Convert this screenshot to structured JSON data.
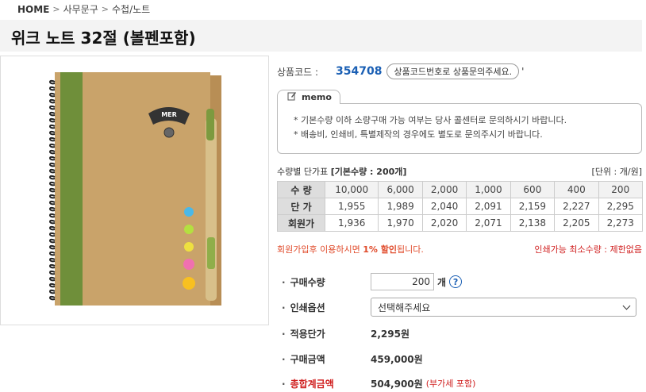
{
  "breadcrumb": {
    "home": "HOME",
    "cat1": "사무문구",
    "cat2": "수첩/노트"
  },
  "product": {
    "title": "위크 노트 32절 (볼펜포함)"
  },
  "code": {
    "label": "상품코드 :",
    "value": "354708",
    "tip": "상품코드번호로 상품문의주세요.",
    "tick": "'"
  },
  "memo": {
    "title": "memo",
    "lines": [
      "* 기본수량 이하 소량구매 가능 여부는 당사 콜센터로 문의하시기 바랍니다.",
      "* 배송비, 인쇄비, 특별제작의 경우에도 별도로 문의주시기 바랍니다."
    ]
  },
  "price_table": {
    "caption_prefix": "수량별 단가표 ",
    "caption_bold": "[기본수량 : 200개]",
    "unit": "[단위 : 개/원]",
    "headers": {
      "qty": "수 량",
      "price": "단 가",
      "member": "회원가"
    },
    "quantities": [
      "10,000",
      "6,000",
      "2,000",
      "1,000",
      "600",
      "400",
      "200"
    ],
    "prices": [
      "1,955",
      "1,989",
      "2,040",
      "2,091",
      "2,159",
      "2,227",
      "2,295"
    ],
    "member_prices": [
      "1,936",
      "1,970",
      "2,020",
      "2,071",
      "2,138",
      "2,205",
      "2,273"
    ]
  },
  "discount": {
    "prefix": "회원가입후 이용하시면 ",
    "rate": "1% 할인",
    "suffix": "됩니다."
  },
  "min_qty": "인쇄가능 최소수량 : 제한없음",
  "order": {
    "qty_label": "구매수량",
    "qty_value": "200",
    "qty_unit": "개",
    "help": "?",
    "print_label": "인쇄옵션",
    "print_selected": "선택해주세요",
    "unit_price_label": "적용단가",
    "unit_price": "2,295원",
    "amount_label": "구매금액",
    "amount": "459,000원",
    "total_label": "총합계금액",
    "total": "504,900원",
    "vat": "(부가세 포함)"
  },
  "image": {
    "badge": "MER"
  },
  "colors": {
    "accent_blue": "#1a5fb4",
    "discount_red": "#e04a2a",
    "kraft": "#c9a36a",
    "spine_green": "#6f8f3a"
  }
}
